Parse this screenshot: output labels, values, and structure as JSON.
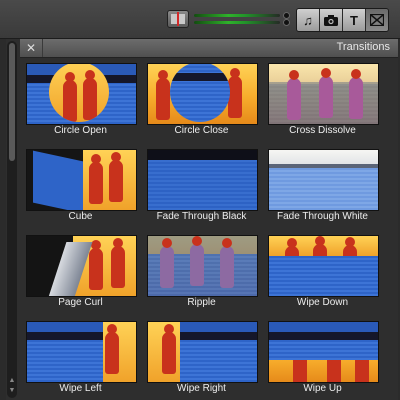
{
  "toolbar": {
    "buttons": [
      {
        "name": "music-icon",
        "glyph": "♫"
      },
      {
        "name": "camera-icon",
        "glyph": "◘"
      },
      {
        "name": "title-icon",
        "glyph": "T"
      },
      {
        "name": "transitions-icon",
        "glyph": "⊠"
      }
    ]
  },
  "panel": {
    "title": "Transitions",
    "close_glyph": "✕"
  },
  "transitions": [
    {
      "label": "Circle Open"
    },
    {
      "label": "Circle Close"
    },
    {
      "label": "Cross Dissolve"
    },
    {
      "label": "Cube"
    },
    {
      "label": "Fade Through Black"
    },
    {
      "label": "Fade Through White"
    },
    {
      "label": "Page Curl"
    },
    {
      "label": "Ripple"
    },
    {
      "label": "Wipe Down"
    },
    {
      "label": "Wipe Left"
    },
    {
      "label": "Wipe Right"
    },
    {
      "label": "Wipe Up"
    }
  ],
  "colors": {
    "water": "#2e64c8",
    "sunset": "#f7ad2c",
    "rider": "#c8321c",
    "meter_green": "#2fb22b"
  }
}
